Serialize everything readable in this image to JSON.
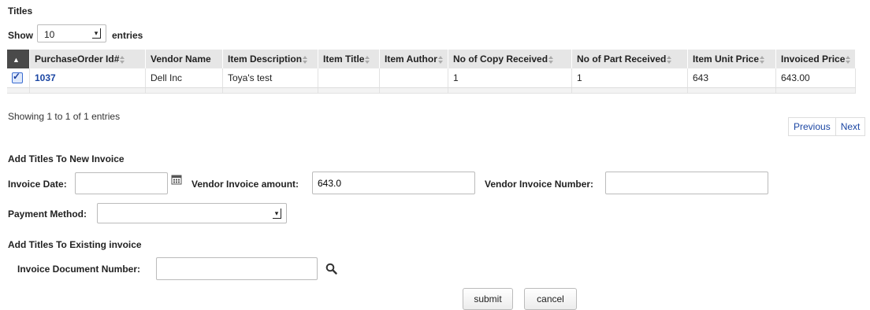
{
  "page": {
    "titles_heading": "Titles"
  },
  "length": {
    "show_label": "Show",
    "value": "10",
    "entries_label": "entries"
  },
  "table": {
    "headers": [
      "PurchaseOrder Id#",
      "Vendor Name",
      "Item Description",
      "Item Title",
      "Item Author",
      "No of Copy Received",
      "No of Part Received",
      "Item Unit Price",
      "Invoiced Price"
    ],
    "rows": [
      {
        "checked": true,
        "po_id": "1037",
        "vendor_name": "Dell Inc",
        "item_description": "Toya's test",
        "item_title": "",
        "item_author": "",
        "copies_received": "1",
        "parts_received": "1",
        "unit_price": "643",
        "invoiced_price": "643.00"
      }
    ]
  },
  "info": {
    "text": "Showing 1 to 1 of 1 entries"
  },
  "pager": {
    "previous": "Previous",
    "next": "Next"
  },
  "new_invoice": {
    "heading": "Add Titles To New Invoice",
    "invoice_date_label": "Invoice Date:",
    "invoice_date_value": "",
    "vendor_amount_label": "Vendor Invoice amount:",
    "vendor_amount_value": "643.0",
    "vendor_number_label": "Vendor Invoice Number:",
    "vendor_number_value": "",
    "payment_method_label": "Payment Method:",
    "payment_method_value": ""
  },
  "existing_invoice": {
    "heading": "Add Titles To Existing invoice",
    "doc_number_label": "Invoice Document Number:",
    "doc_number_value": ""
  },
  "actions": {
    "submit": "submit",
    "cancel": "cancel"
  }
}
